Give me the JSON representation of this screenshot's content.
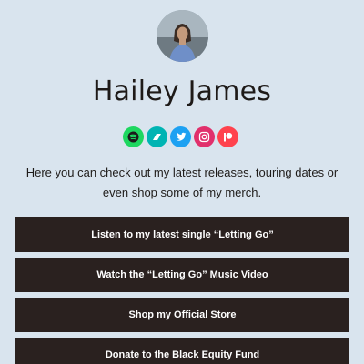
{
  "profile": {
    "name": "Hailey James",
    "avatar": "avatar-photo"
  },
  "socials": [
    {
      "name": "spotify",
      "icon": "spotify-icon",
      "color": "#1ed760"
    },
    {
      "name": "bandsintown",
      "icon": "bandsintown-icon",
      "color": "#00b4b3"
    },
    {
      "name": "twitter",
      "icon": "twitter-icon",
      "color": "#1da1f2"
    },
    {
      "name": "instagram",
      "icon": "instagram-icon",
      "color": "#e1306c"
    },
    {
      "name": "patreon",
      "icon": "patreon-icon",
      "color": "#ff424d"
    }
  ],
  "bio": "Here you can check out my latest releases, touring dates or even shop some of my merch.",
  "links": [
    {
      "label": "Listen to my latest single “Letting Go”"
    },
    {
      "label": "Watch the “Letting Go” Music Video"
    },
    {
      "label": "Shop my Official Store"
    },
    {
      "label": "Donate to the Black Equity Fund"
    }
  ],
  "colors": {
    "background": "#d9e4ee",
    "button": "#2a211f",
    "button_text": "#ffffff",
    "text": "#1e1a18"
  }
}
